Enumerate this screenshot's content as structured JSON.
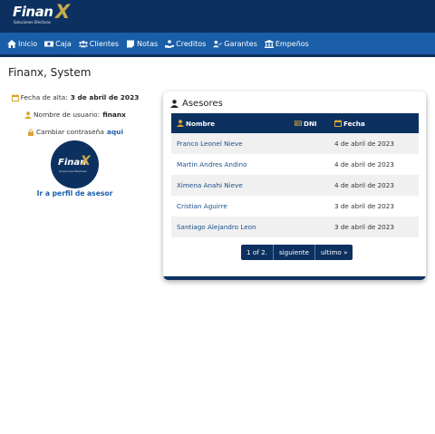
{
  "brand": {
    "name": "Finan",
    "x": "X",
    "tagline": "Soluciones Efectivas"
  },
  "nav": {
    "items": [
      {
        "label": "Inicio",
        "icon": "home-icon"
      },
      {
        "label": "Caja",
        "icon": "money-icon"
      },
      {
        "label": "Clientes",
        "icon": "users-icon"
      },
      {
        "label": "Notas",
        "icon": "note-icon"
      },
      {
        "label": "Creditos",
        "icon": "hand-coin-icon"
      },
      {
        "label": "Garantes",
        "icon": "user-check-icon"
      },
      {
        "label": "Empeños",
        "icon": "bank-icon"
      }
    ]
  },
  "page": {
    "title": "Finanx, System"
  },
  "profile": {
    "fecha_label": "Fecha de alta:",
    "fecha_value": "3 de abril de 2023",
    "usuario_label": "Nombre de usuario:",
    "usuario_value": "finanx",
    "password_label": "Cambiar contraseña",
    "password_link": "aqui",
    "avatar_word": "Finan",
    "avatar_x": "X",
    "avatar_tagline": "Soluciones Efectivas",
    "profile_link": "Ir a perfil de asesor"
  },
  "asesores": {
    "title": "Asesores",
    "columns": {
      "nombre": "Nombre",
      "dni": "DNI",
      "fecha": "Fecha"
    },
    "rows": [
      {
        "nombre": "Franco Leonel Nieve",
        "dni": "",
        "fecha": "4 de abril de 2023"
      },
      {
        "nombre": "Martin Andres Andino",
        "dni": "",
        "fecha": "4 de abril de 2023"
      },
      {
        "nombre": "Ximena Anahi Nieve",
        "dni": "",
        "fecha": "4 de abril de 2023"
      },
      {
        "nombre": "Cristian Aguirre",
        "dni": "",
        "fecha": "3 de abril de 2023"
      },
      {
        "nombre": "Santiago Alejandro Leon",
        "dni": "",
        "fecha": "3 de abril de 2023"
      }
    ],
    "pager": {
      "page": "1 of 2.",
      "next": "siguiente",
      "last": "ultimo »"
    }
  },
  "colors": {
    "navy": "#0c3160",
    "nav_blue": "#1a5ea8",
    "gold": "#d9a531"
  }
}
